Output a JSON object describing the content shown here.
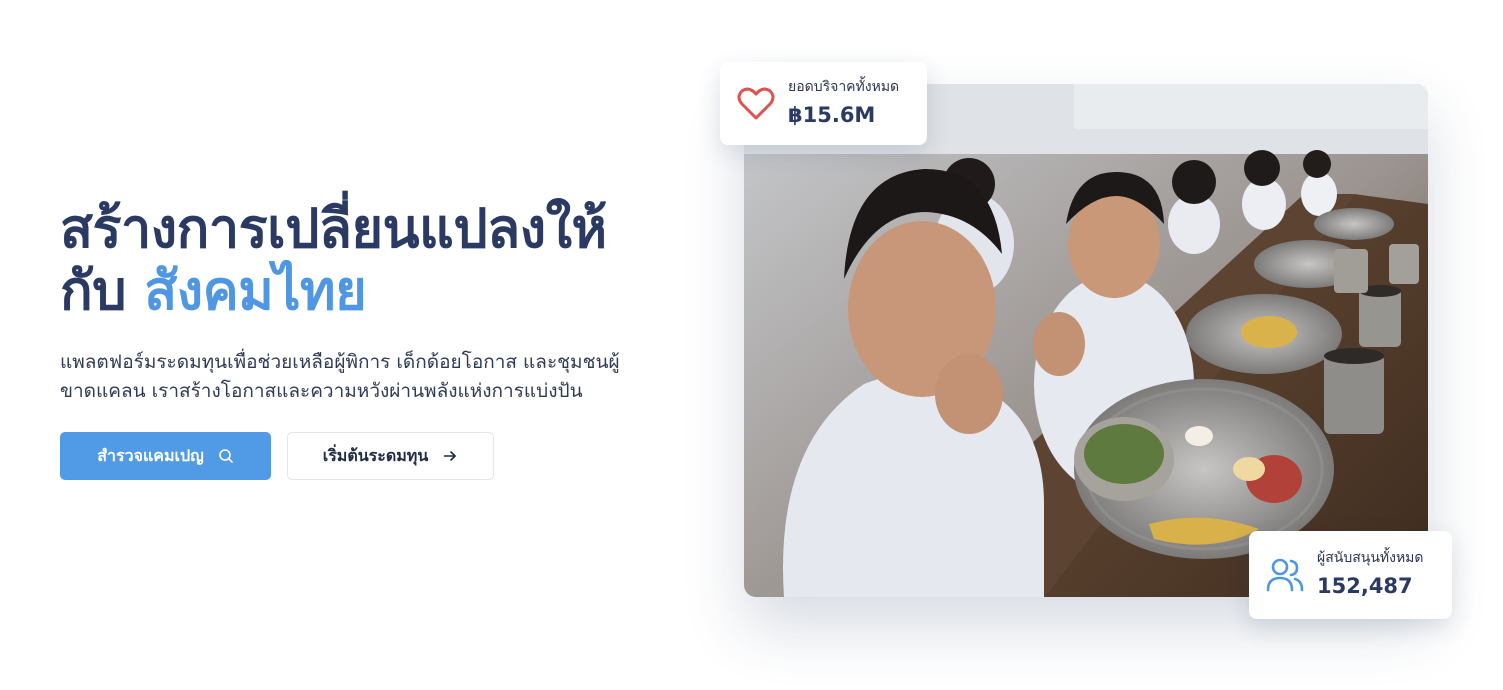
{
  "hero": {
    "title_line1": "สร้างการเปลี่ยนแปลงให้",
    "title_line2_prefix": "กับ",
    "title_line2_accent": "สังคมไทย",
    "subtitle": "แพลตฟอร์มระดมทุนเพื่อช่วยเหลือผู้พิการ เด็กด้อยโอกาส และชุมชนผู้ขาดแคลน เราสร้างโอกาสและความหวังผ่านพลังแห่งการแบ่งปัน",
    "primary_button": {
      "label": "สำรวจแคมเปญ",
      "icon": "search-icon"
    },
    "secondary_button": {
      "label": "เริ่มต้นระดมทุน",
      "icon": "arrow-right-icon"
    }
  },
  "stats": {
    "donations": {
      "label": "ยอดบริจาคทั้งหมด",
      "value": "฿15.6M",
      "icon": "heart-icon"
    },
    "supporters": {
      "label": "ผู้สนับสนุนทั้งหมด",
      "value": "152,487",
      "icon": "users-icon"
    }
  },
  "colors": {
    "title": "#2b3a63",
    "accent": "#4f97e3",
    "primary_button": "#519be6",
    "heart": "#e0524f"
  }
}
